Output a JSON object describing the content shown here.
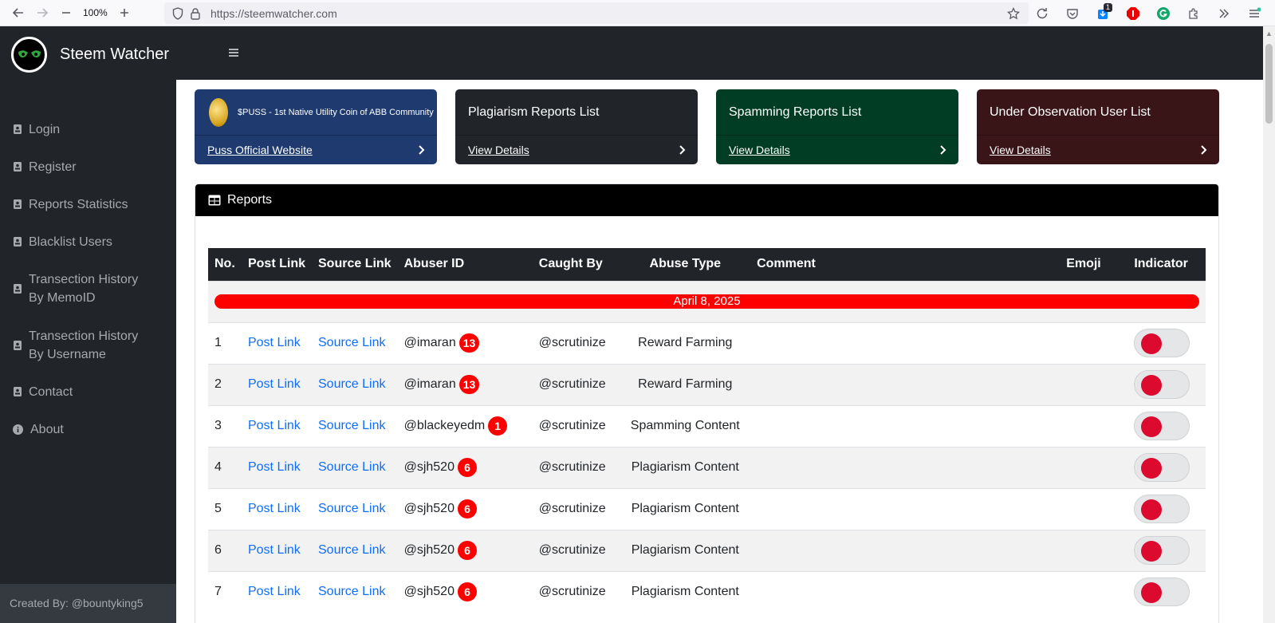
{
  "browser": {
    "zoom": "100%",
    "url": "https://steemwatcher.com",
    "extension_badge": "1"
  },
  "site": {
    "brand": "Steem Watcher"
  },
  "sidebar": {
    "items": [
      {
        "label": "Login"
      },
      {
        "label": "Register"
      },
      {
        "label": "Reports Statistics"
      },
      {
        "label": "Blacklist Users"
      },
      {
        "label": "Transection History By MemoID"
      },
      {
        "label": "Transection History By Username"
      },
      {
        "label": "Contact"
      },
      {
        "label": "About"
      }
    ],
    "footer": "Created By: @bountyking5"
  },
  "cards": [
    {
      "title": "$PUSS - 1st Native Utility Coin of ABB Community",
      "link": "Puss Official Website",
      "color": "#1e3a6e"
    },
    {
      "title": "Plagiarism Reports List",
      "link": "View Details",
      "color": "#212529"
    },
    {
      "title": "Spamming Reports List",
      "link": "View Details",
      "color": "#003d24"
    },
    {
      "title": "Under Observation User List",
      "link": "View Details",
      "color": "#3a1518"
    }
  ],
  "reports": {
    "title": "Reports",
    "columns": [
      "No.",
      "Post Link",
      "Source Link",
      "Abuser ID",
      "Caught By",
      "Abuse Type",
      "Comment",
      "Emoji",
      "Indicator"
    ],
    "date": "April 8, 2025",
    "rows": [
      {
        "no": "1",
        "post": "Post Link",
        "source": "Source Link",
        "abuser": "@imaran",
        "count": "13",
        "caught": "@scrutinize",
        "type": "Reward Farming"
      },
      {
        "no": "2",
        "post": "Post Link",
        "source": "Source Link",
        "abuser": "@imaran",
        "count": "13",
        "caught": "@scrutinize",
        "type": "Reward Farming"
      },
      {
        "no": "3",
        "post": "Post Link",
        "source": "Source Link",
        "abuser": "@blackeyedm",
        "count": "1",
        "caught": "@scrutinize",
        "type": "Spamming Content"
      },
      {
        "no": "4",
        "post": "Post Link",
        "source": "Source Link",
        "abuser": "@sjh520",
        "count": "6",
        "caught": "@scrutinize",
        "type": "Plagiarism Content"
      },
      {
        "no": "5",
        "post": "Post Link",
        "source": "Source Link",
        "abuser": "@sjh520",
        "count": "6",
        "caught": "@scrutinize",
        "type": "Plagiarism Content"
      },
      {
        "no": "6",
        "post": "Post Link",
        "source": "Source Link",
        "abuser": "@sjh520",
        "count": "6",
        "caught": "@scrutinize",
        "type": "Plagiarism Content"
      },
      {
        "no": "7",
        "post": "Post Link",
        "source": "Source Link",
        "abuser": "@sjh520",
        "count": "6",
        "caught": "@scrutinize",
        "type": "Plagiarism Content"
      }
    ]
  },
  "colors": {
    "badge": "#ff0000",
    "link": "#0d6efd",
    "indicator": "#dc0a2e"
  }
}
